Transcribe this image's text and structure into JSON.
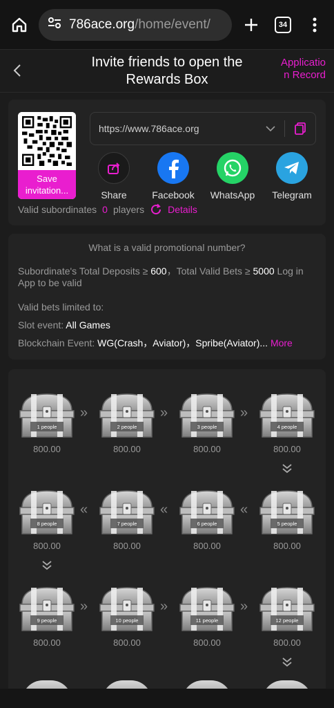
{
  "browser": {
    "url_host": "786ace.org",
    "url_path": "/home/event/",
    "tab_count": "34"
  },
  "header": {
    "title": "Invite friends to open the Rewards Box",
    "link": "Application Record"
  },
  "invite": {
    "save_label": "Save invitation...",
    "link_value": "https://www.786ace.org",
    "share": [
      {
        "label": "Share",
        "icon": "share-icon"
      },
      {
        "label": "Facebook",
        "icon": "facebook-icon"
      },
      {
        "label": "WhatsApp",
        "icon": "whatsapp-icon"
      },
      {
        "label": "Telegram",
        "icon": "telegram-icon"
      }
    ],
    "valid_label": "Valid subordinates",
    "valid_count": "0",
    "valid_unit": "players",
    "details_label": "Details"
  },
  "rules": {
    "title": "What is a valid promotional number?",
    "line1_pre": "Subordinate's Total Deposits ≥ ",
    "line1_dep": "600",
    "line1_mid": "，Total Valid Bets ≥ ",
    "line1_bet": "5000",
    "line1_post": " Log in App to be valid",
    "limited": "Valid bets limited to:",
    "slot_label": "Slot event: ",
    "slot_value": "All Games",
    "chain_label": "Blockchain Event: ",
    "chain_value": "WG(Crash，Aviator)，Spribe(Aviator)...",
    "more_label": "More"
  },
  "boxes": [
    {
      "label": "1 people",
      "amount": "800.00"
    },
    {
      "label": "2 people",
      "amount": "800.00"
    },
    {
      "label": "3 people",
      "amount": "800.00"
    },
    {
      "label": "4 people",
      "amount": "800.00"
    },
    {
      "label": "5 people",
      "amount": "800.00"
    },
    {
      "label": "6 people",
      "amount": "800.00"
    },
    {
      "label": "7 people",
      "amount": "800.00"
    },
    {
      "label": "8 people",
      "amount": "800.00"
    },
    {
      "label": "9 people",
      "amount": "800.00"
    },
    {
      "label": "10 people",
      "amount": "800.00"
    },
    {
      "label": "11 people",
      "amount": "800.00"
    },
    {
      "label": "12 people",
      "amount": "800.00"
    }
  ],
  "colors": {
    "accent": "#e91ecf",
    "facebook": "#1877f2",
    "whatsapp": "#25d366",
    "telegram": "#2aa3e0"
  }
}
